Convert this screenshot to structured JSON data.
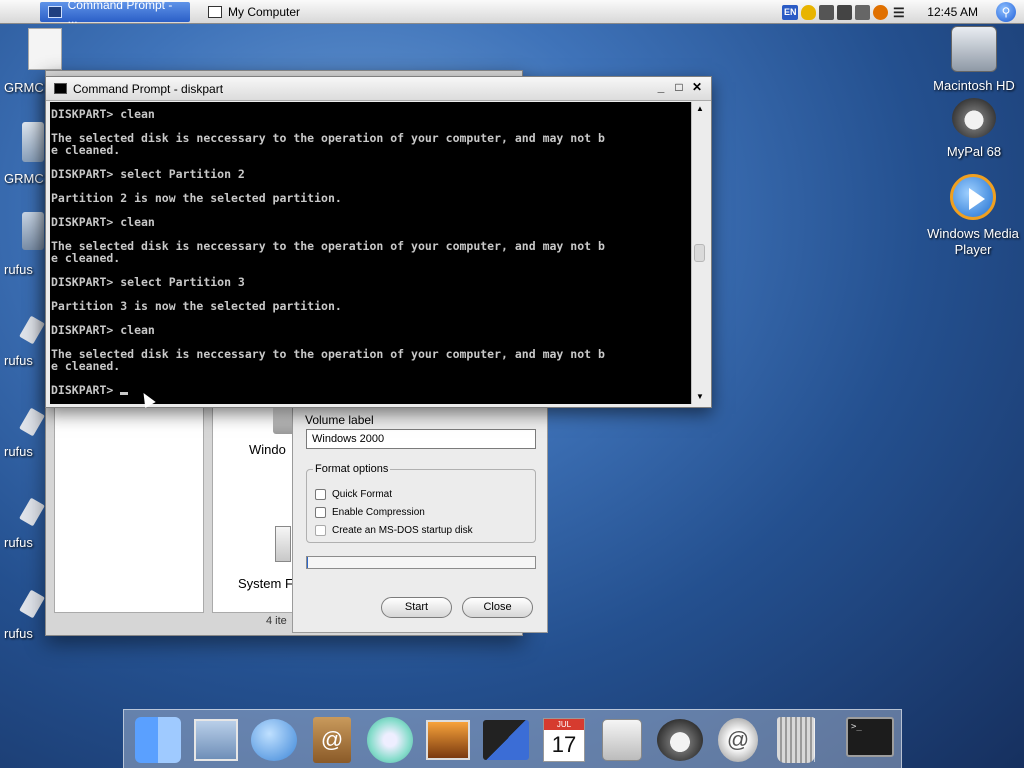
{
  "menubar": {
    "tasks": [
      {
        "label": "Command Prompt - ...",
        "active": true
      },
      {
        "label": "My Computer",
        "active": false
      }
    ],
    "tray_icons": [
      "language-en-icon",
      "security-shield-icon",
      "volume-icon",
      "network-icon",
      "sound-mute-icon",
      "search-tray-icon",
      "list-icon"
    ],
    "lang": "EN",
    "clock": "12:45 AM"
  },
  "desktop": {
    "right_icons": [
      {
        "label": "Macintosh HD",
        "icon": "hard-drive-icon"
      },
      {
        "label": "MyPal 68",
        "icon": "raccoon-browser-icon"
      },
      {
        "label": "Windows Media Player",
        "icon": "media-player-icon"
      }
    ],
    "left_labels": [
      "GRMC",
      "GRMC",
      "rufus",
      "rufus",
      "rufus",
      "rufus",
      "rufus"
    ]
  },
  "explorer": {
    "item_windows": "Windo",
    "item_system": "System F",
    "status": "4 ite"
  },
  "format_dialog": {
    "volume_label_caption": "Volume label",
    "volume_label_value": "Windows 2000",
    "options_legend": "Format options",
    "options": [
      {
        "label": "Quick Format",
        "checked": false
      },
      {
        "label": "Enable Compression",
        "checked": false
      },
      {
        "label": "Create an MS-DOS startup disk",
        "checked": false
      }
    ],
    "progress": 0.0,
    "start_label": "Start",
    "close_label": "Close"
  },
  "cmd": {
    "title": "Command Prompt - diskpart",
    "lines": [
      "DISKPART> clean",
      "",
      "The selected disk is neccessary to the operation of your computer, and may not b",
      "e cleaned.",
      "",
      "DISKPART> select Partition 2",
      "",
      "Partition 2 is now the selected partition.",
      "",
      "DISKPART> clean",
      "",
      "The selected disk is neccessary to the operation of your computer, and may not b",
      "e cleaned.",
      "",
      "DISKPART> select Partition 3",
      "",
      "Partition 3 is now the selected partition.",
      "",
      "DISKPART> clean",
      "",
      "The selected disk is neccessary to the operation of your computer, and may not b",
      "e cleaned.",
      "",
      "DISKPART> "
    ],
    "buttons": {
      "minimize": "_",
      "maximize": "□",
      "close": "✕"
    }
  },
  "dock": {
    "items": [
      "finder-icon",
      "mail-icon",
      "ichat-icon",
      "address-book-icon",
      "itunes-icon",
      "iphoto-icon",
      "imovie-icon",
      "ical-icon",
      "system-preferences-icon",
      "mypal-icon",
      "internet-connect-icon",
      "trash-icon"
    ],
    "ical_month": "JUL",
    "ical_day": "17",
    "terminal_prompt": ">_"
  }
}
